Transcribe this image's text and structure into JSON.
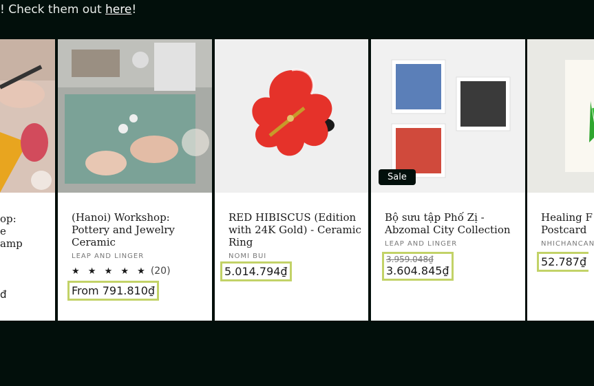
{
  "banner": {
    "text_before": "! Check them out ",
    "link": "here",
    "text_after": "!"
  },
  "products": [
    {
      "title_lines": [
        "op:",
        "e",
        "amp"
      ],
      "price_fragment": "đ"
    },
    {
      "title": "(Hanoi) Workshop: Pottery and Jewelry Ceramic",
      "vendor": "LEAP AND LINGER",
      "stars": "★ ★ ★ ★ ★",
      "rating_count": "(20)",
      "price": "From 791.810₫"
    },
    {
      "title": "RED HIBISCUS (Edition with 24K Gold) - Ceramic Ring",
      "vendor": "NOMI BUI",
      "price": "5.014.794₫"
    },
    {
      "title": "Bộ sưu tập Phố Zị - Abzomal City Collection",
      "vendor": "LEAP AND LINGER",
      "badge": "Sale",
      "old_price": "3.959.048₫",
      "price": "3.604.845₫"
    },
    {
      "title": "Healing F Postcard",
      "vendor": "NHICHANCAN",
      "price": "52.787₫"
    }
  ],
  "colors": {
    "background": "#020f0b",
    "price_highlight": "#c2d267",
    "badge_bg": "#020f0b"
  }
}
